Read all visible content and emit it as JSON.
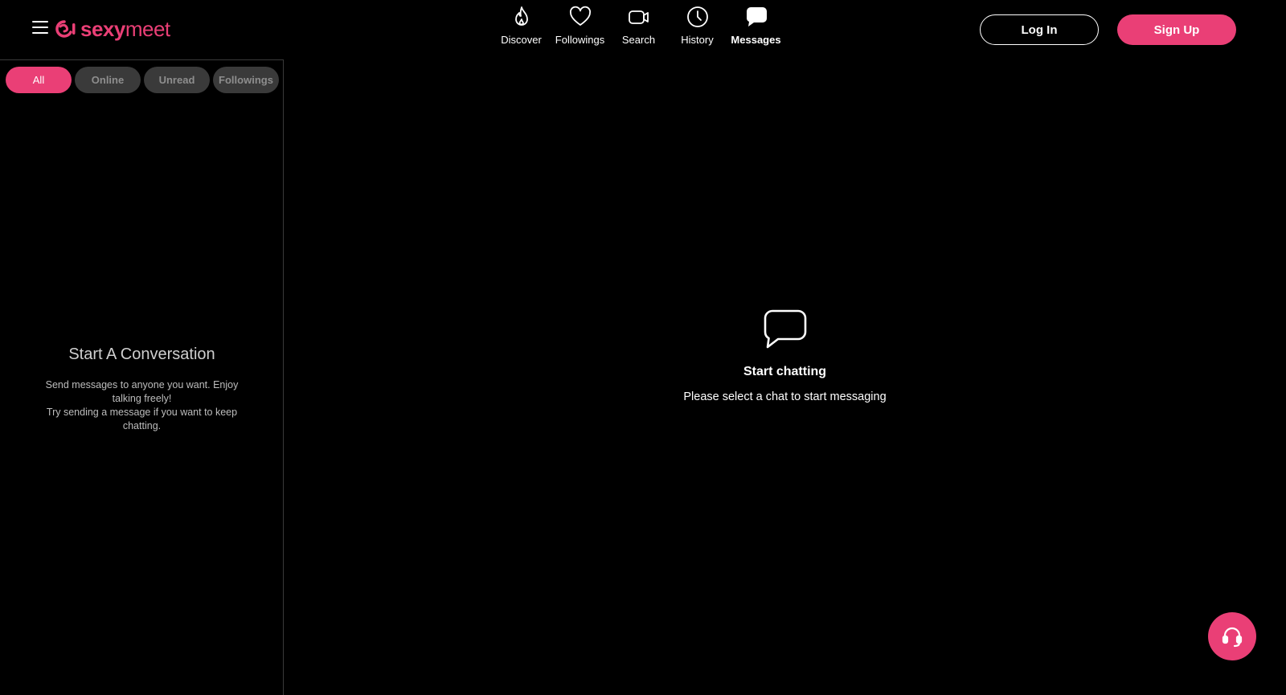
{
  "colors": {
    "accent": "#ea3f76",
    "background": "#000000",
    "pill": "#3a3a3a"
  },
  "header": {
    "logo": {
      "text_bold": "sexy",
      "text_regular": "meet"
    },
    "nav": [
      {
        "label": "Discover",
        "icon": "flame-icon"
      },
      {
        "label": "Followings",
        "icon": "heart-icon"
      },
      {
        "label": "Search",
        "icon": "video-camera-icon"
      },
      {
        "label": "History",
        "icon": "clock-icon"
      },
      {
        "label": "Messages",
        "icon": "chat-bubble-icon",
        "active": true
      }
    ],
    "login_label": "Log In",
    "signup_label": "Sign Up"
  },
  "sidebar": {
    "filters": [
      {
        "label": "All",
        "active": true
      },
      {
        "label": "Online"
      },
      {
        "label": "Unread"
      },
      {
        "label": "Followings"
      }
    ],
    "empty_title": "Start A Conversation",
    "empty_desc_line1": "Send messages to anyone you want. Enjoy talking freely!",
    "empty_desc_line2": "Try sending a message if you want to keep chatting."
  },
  "main": {
    "icon": "chat-bubble-outline-icon",
    "title": "Start chatting",
    "subtitle": "Please select a chat to start messaging"
  },
  "support": {
    "icon": "headset-icon"
  }
}
